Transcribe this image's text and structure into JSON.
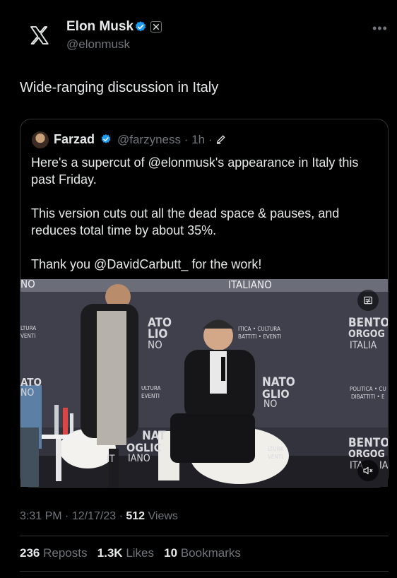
{
  "author": {
    "name": "Elon Musk",
    "handle": "@elonmusk"
  },
  "tweet": {
    "text": "Wide-ranging discussion in Italy"
  },
  "more_label": "•••",
  "quote": {
    "name": "Farzad",
    "handle": "@farzyness",
    "dot": "·",
    "time": "1h",
    "dot2": "·",
    "paragraphs": [
      "Here's a supercut of @elonmusk's appearance in Italy this past Friday.",
      "This version cuts out all the dead space & pauses, and reduces total time by about 35%.",
      "Thank you @DavidCarbutt_ for the work!"
    ]
  },
  "video": {
    "banner_top": "ITALIANO",
    "banner_left": "NO",
    "left_wall_1": "LTURA",
    "left_wall_2": "VENTI",
    "center_big_1": "ATO",
    "center_big_2": "LIO",
    "center_big_3": "NO",
    "center_small_1": "ITICA • CULTURA",
    "center_small_2": "BATTITI • EVENTI",
    "right_big_1": "BENTOR",
    "right_big_2": "ORGOG",
    "right_big_3": "ITALIA",
    "right_small_1": "POLITICA • CU",
    "right_small_2": "DIBATTITI • E",
    "lower_mid_1": "NATO",
    "lower_mid_2": "GLIO",
    "lower_mid_3": "NO",
    "lower_mid_small_1": "LTURA",
    "lower_mid_small_2": "VENTI",
    "lower_left_big_1": "NAT",
    "lower_left_big_2": "OGLIC",
    "lower_left_big_3": "IANO",
    "lower_left_stub": "IT",
    "lower_center_small_1": "LTURA",
    "lower_center_small_2": "VENTI",
    "left_edge_1": "ATO",
    "left_edge_2": "NO",
    "right_lower_1": "BENTOR",
    "right_lower_2": "ORGOG",
    "right_lower_3": "ITA",
    "right_lower_4": "IA",
    "under_left_1": "ULTURA",
    "under_left_2": "EVENTI"
  },
  "meta": {
    "time": "3:31 PM",
    "sep1": "·",
    "date": "12/17/23",
    "sep2": "·",
    "views_count": "512",
    "views_label": "Views"
  },
  "stats": {
    "reposts_count": "236",
    "reposts_label": "Reposts",
    "likes_count": "1.3K",
    "likes_label": "Likes",
    "bookmarks_count": "10",
    "bookmarks_label": "Bookmarks"
  },
  "colors": {
    "background": "#000000",
    "text": "#e7e9ea",
    "muted": "#71767b",
    "verified": "#1d9bf0",
    "border": "#2f3336"
  },
  "icons": [
    "x-logo-icon",
    "verified-icon",
    "x-badge-icon",
    "more-icon",
    "pencil-icon",
    "gif-icon",
    "mute-icon"
  ]
}
